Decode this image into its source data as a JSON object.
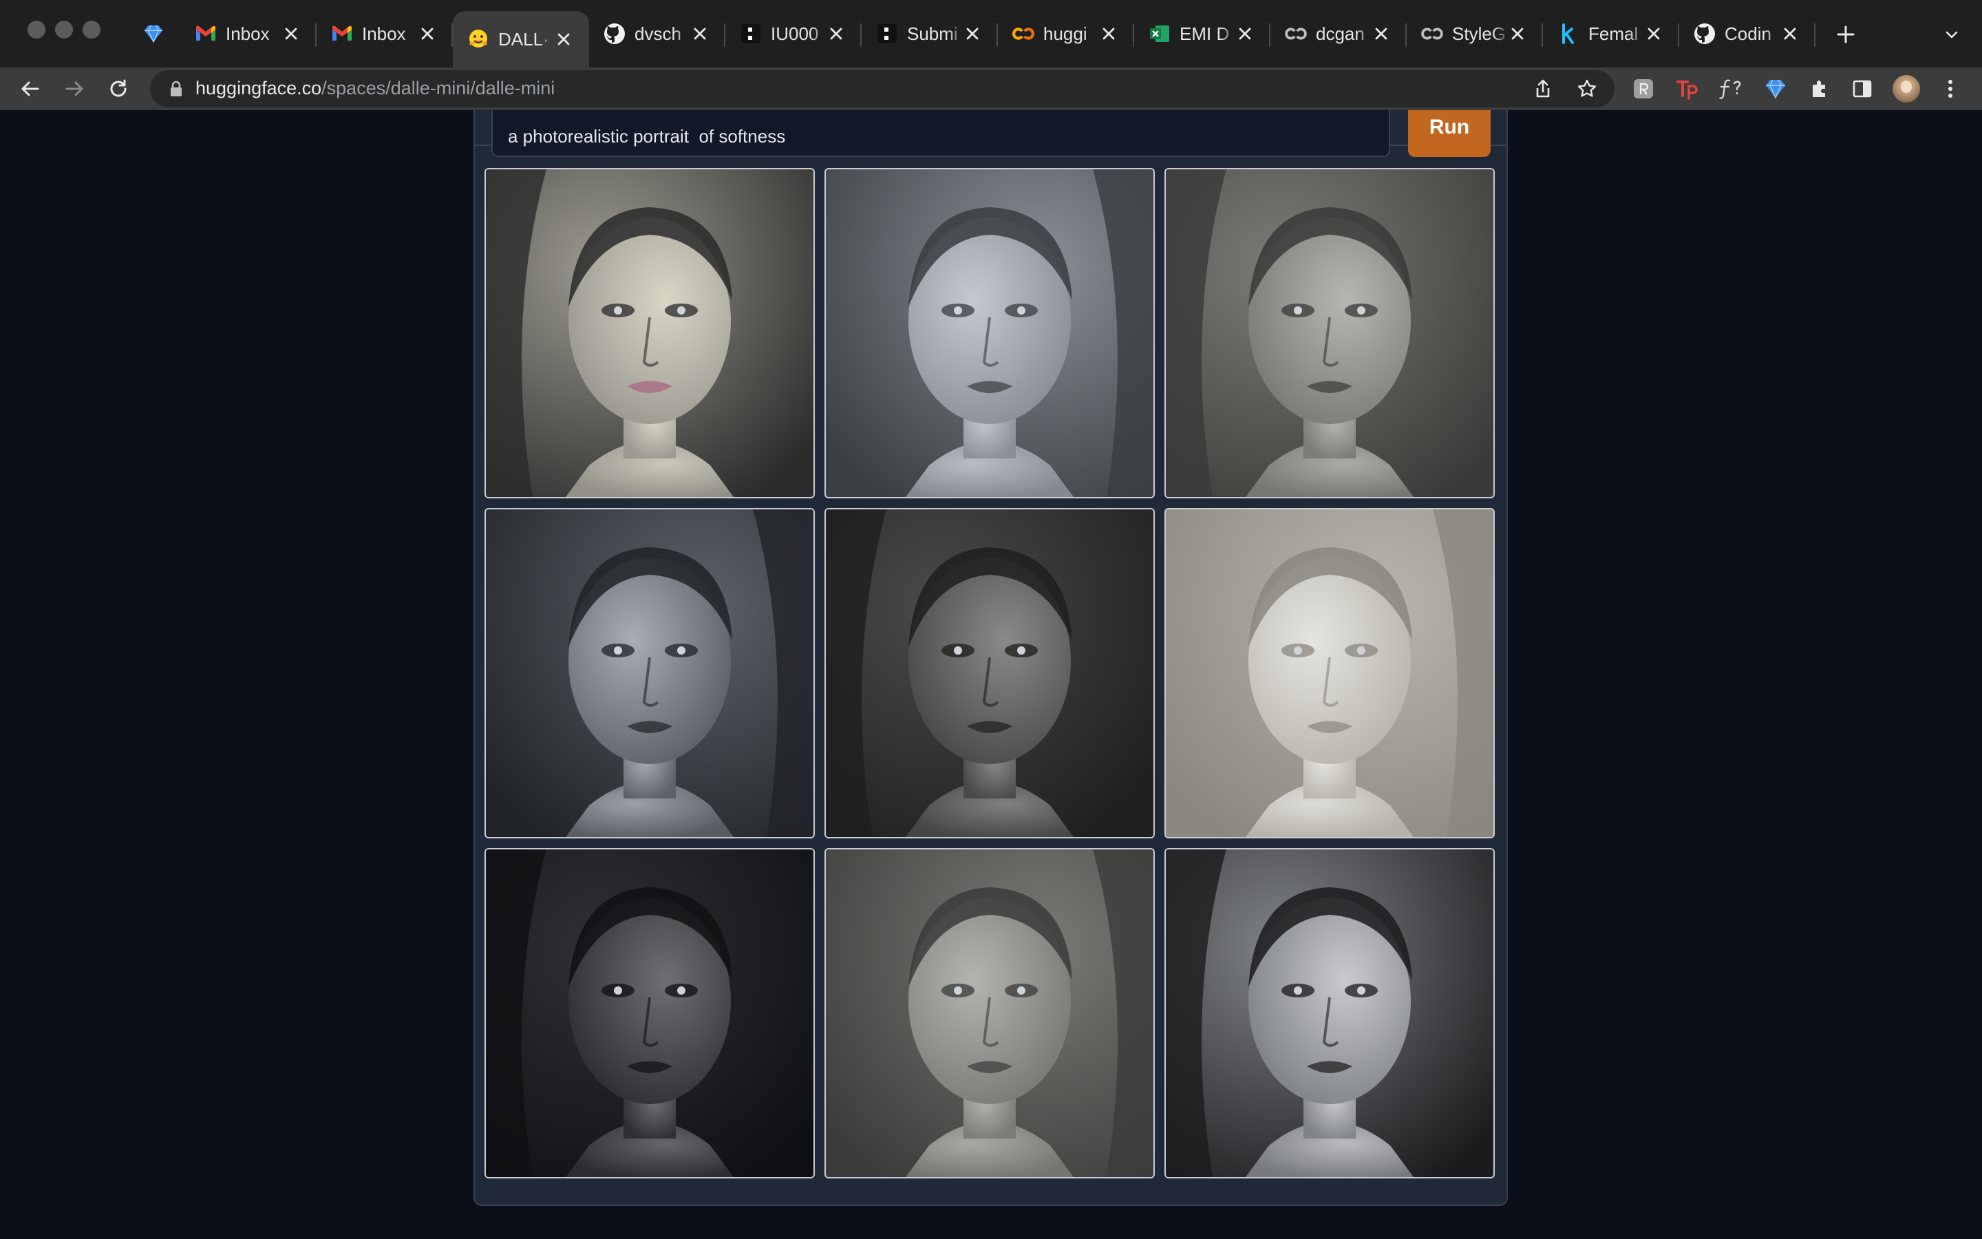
{
  "browser": {
    "tabs": [
      {
        "title": "",
        "favicon": "gem-icon",
        "pinned": true
      },
      {
        "title": "Inbox",
        "favicon": "gmail-icon"
      },
      {
        "title": "Inbox",
        "favicon": "gmail-icon"
      },
      {
        "title": "DALL·",
        "favicon": "huggingface-icon",
        "active": true
      },
      {
        "title": "dvsch",
        "favicon": "github-icon"
      },
      {
        "title": "IU000",
        "favicon": "dark-app-icon"
      },
      {
        "title": "Submi",
        "favicon": "dark-app-icon"
      },
      {
        "title": "huggi",
        "favicon": "colab-icon"
      },
      {
        "title": "EMI D",
        "favicon": "excel-icon"
      },
      {
        "title": "dcgan",
        "favicon": "colab-icon"
      },
      {
        "title": "StyleG",
        "favicon": "colab-icon"
      },
      {
        "title": "Femal",
        "favicon": "k-icon"
      },
      {
        "title": "Codin",
        "favicon": "github-icon"
      }
    ],
    "address": {
      "domain": "huggingface.co",
      "path": "/spaces/dalle-mini/dalle-mini"
    },
    "extensions": [
      "puzzle-r-icon",
      "tp-icon",
      "fx-icon",
      "gem-icon",
      "extensions-puzzle-icon",
      "side-panel-icon",
      "profile-avatar"
    ]
  },
  "app": {
    "prompt_value": "a photorealistic portrait  of softness",
    "run_label": "Run",
    "accent": "#c2671f",
    "background": "#0b0f19",
    "panel_bg": "#1f2937",
    "images": [
      {
        "name": "generated-image-1",
        "tone": [
          "#d9d6c6",
          "#9c9a90",
          "#2a2a2a"
        ]
      },
      {
        "name": "generated-image-2",
        "tone": [
          "#c4c9cf",
          "#8a9096",
          "#3a3d42"
        ]
      },
      {
        "name": "generated-image-3",
        "tone": [
          "#b8b6b0",
          "#7d7b76",
          "#3b3a38"
        ]
      },
      {
        "name": "generated-image-4",
        "tone": [
          "#a9adb3",
          "#5e6268",
          "#202328"
        ]
      },
      {
        "name": "generated-image-5",
        "tone": [
          "#8a8a88",
          "#4a4a48",
          "#1e1e1e"
        ]
      },
      {
        "name": "generated-image-6",
        "tone": [
          "#e6e4df",
          "#b9b6af",
          "#8a877f"
        ]
      },
      {
        "name": "generated-image-7",
        "tone": [
          "#6d6f73",
          "#2e3034",
          "#0f1013"
        ]
      },
      {
        "name": "generated-image-8",
        "tone": [
          "#b3b4b0",
          "#7a7b77",
          "#3b3c39"
        ]
      },
      {
        "name": "generated-image-9",
        "tone": [
          "#c8cacd",
          "#808387",
          "#1a1b1d"
        ]
      }
    ]
  }
}
